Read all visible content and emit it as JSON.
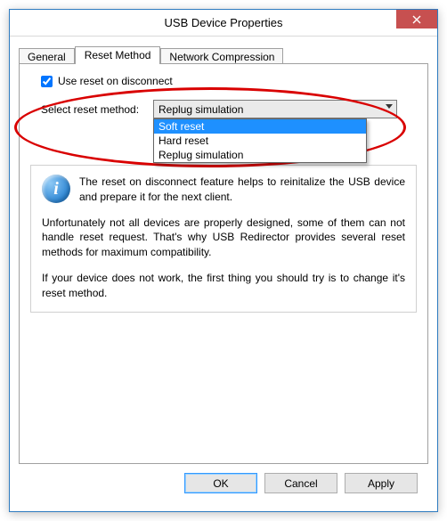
{
  "window": {
    "title": "USB Device Properties",
    "close_label": "Close"
  },
  "tabs": {
    "general": "General",
    "reset": "Reset Method",
    "netcomp": "Network Compression"
  },
  "reset_panel": {
    "use_reset_label": "Use reset on disconnect",
    "use_reset_checked": true,
    "select_label": "Select reset method:",
    "combo_value": "Replug simulation",
    "options": {
      "soft": "Soft reset",
      "hard": "Hard reset",
      "replug": "Replug simulation"
    }
  },
  "info": {
    "icon_glyph": "i",
    "p1": "The reset on disconnect feature helps to reinitalize the USB device and prepare it for the next client.",
    "p2": "Unfortunately not all devices are properly designed, some of them can not handle reset request. That's why USB Redirector provides several reset methods for maximum compatibility.",
    "p3": "If your device does not work, the first thing you should try is to change it's reset method."
  },
  "buttons": {
    "ok": "OK",
    "cancel": "Cancel",
    "apply": "Apply"
  }
}
